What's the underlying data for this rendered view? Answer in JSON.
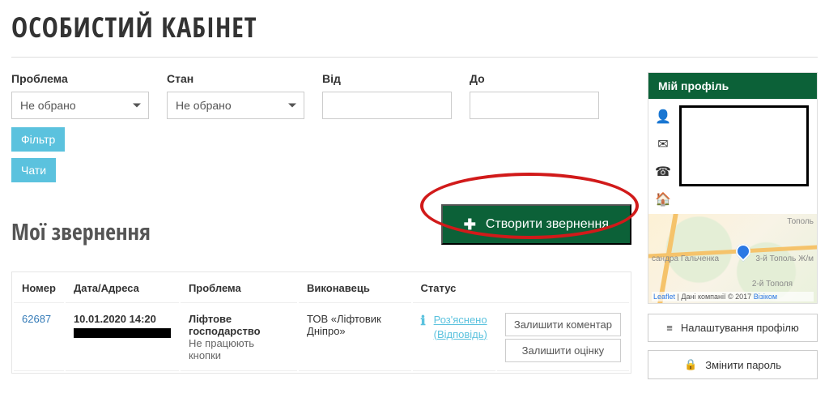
{
  "page_title": "ОСОБИСТИЙ КАБІНЕТ",
  "filters": {
    "problem": {
      "label": "Проблема",
      "selected": "Не обрано"
    },
    "state": {
      "label": "Стан",
      "selected": "Не обрано"
    },
    "from": {
      "label": "Від",
      "value": ""
    },
    "to": {
      "label": "До",
      "value": ""
    }
  },
  "buttons": {
    "filter": "Фільтр",
    "chats": "Чати",
    "create_request": "Створити звернення",
    "settings_profile": "Налаштування профілю",
    "change_password": "Змінити пароль",
    "leave_comment": "Залишити коментар",
    "leave_rating": "Залишити оцінку"
  },
  "section_title": "Мої звернення",
  "table": {
    "headers": {
      "number": "Номер",
      "date_address": "Дата/Адреса",
      "problem": "Проблема",
      "executor": "Виконавець",
      "status": "Статус"
    },
    "rows": [
      {
        "number": "62687",
        "date": "10.01.2020 14:20",
        "problem_title": "Ліфтове господарство",
        "problem_sub": "Не працюють кнопки",
        "executor": "ТОВ «Ліфтовик Дніпро»",
        "status_line1": "Роз'яснено",
        "status_line2": "(Відповідь)"
      }
    ]
  },
  "sidebar": {
    "profile_header": "Мій профіль",
    "map": {
      "label_topolia": "Тополь",
      "label_halchenka": "сандра Гальченка",
      "label_topol3": "3-й Тополь Ж/м",
      "label_topol2": "2-й Тополя",
      "attrib_leaflet": "Leaflet",
      "attrib_mid": " | Дані компанії © 2017 ",
      "attrib_visicom": "Візіком"
    }
  }
}
